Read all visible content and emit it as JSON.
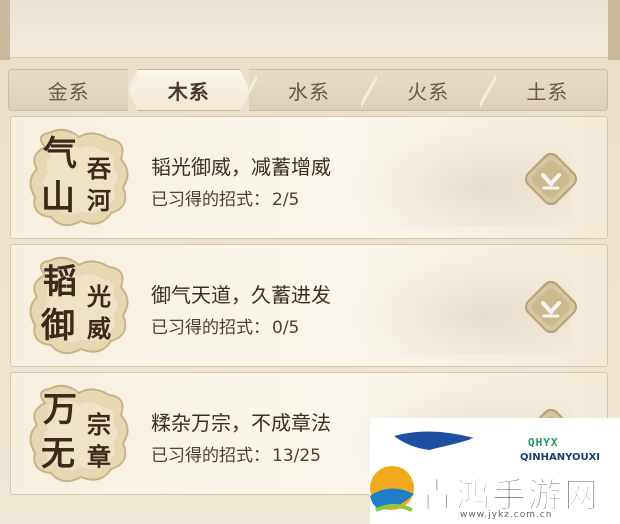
{
  "tabs": [
    {
      "label": "金系",
      "active": false
    },
    {
      "label": "木系",
      "active": true
    },
    {
      "label": "水系",
      "active": false
    },
    {
      "label": "火系",
      "active": false
    },
    {
      "label": "土系",
      "active": false
    }
  ],
  "skills": [
    {
      "emblem": [
        "气",
        "山",
        "吞",
        "河"
      ],
      "title": "韬光御威，减蓄增威",
      "progress_label": "已习得的招式：",
      "progress_value": "2/5"
    },
    {
      "emblem": [
        "韬",
        "御",
        "光",
        "威"
      ],
      "title": "御气天道，久蓄进发",
      "progress_label": "已习得的招式：",
      "progress_value": "0/5"
    },
    {
      "emblem": [
        "万",
        "无",
        "宗",
        "章"
      ],
      "title": "糅杂万宗，不成章法",
      "progress_label": "已习得的招式：",
      "progress_value": "13/25"
    }
  ],
  "icons": {
    "expand": "chevron-down-diamond-icon",
    "emblem_frame": "cloud-badge-icon"
  },
  "colors": {
    "text_primary": "#3b2f22",
    "badge_fill": "#d9c9a2",
    "badge_arrow": "#ffffff",
    "badge_border": "#b5a06f"
  },
  "watermark": {
    "brand": "QHYX",
    "sub": "QINHANYOUXI",
    "name": "青鸿手游网",
    "url": "www.jykz.com.cn"
  }
}
